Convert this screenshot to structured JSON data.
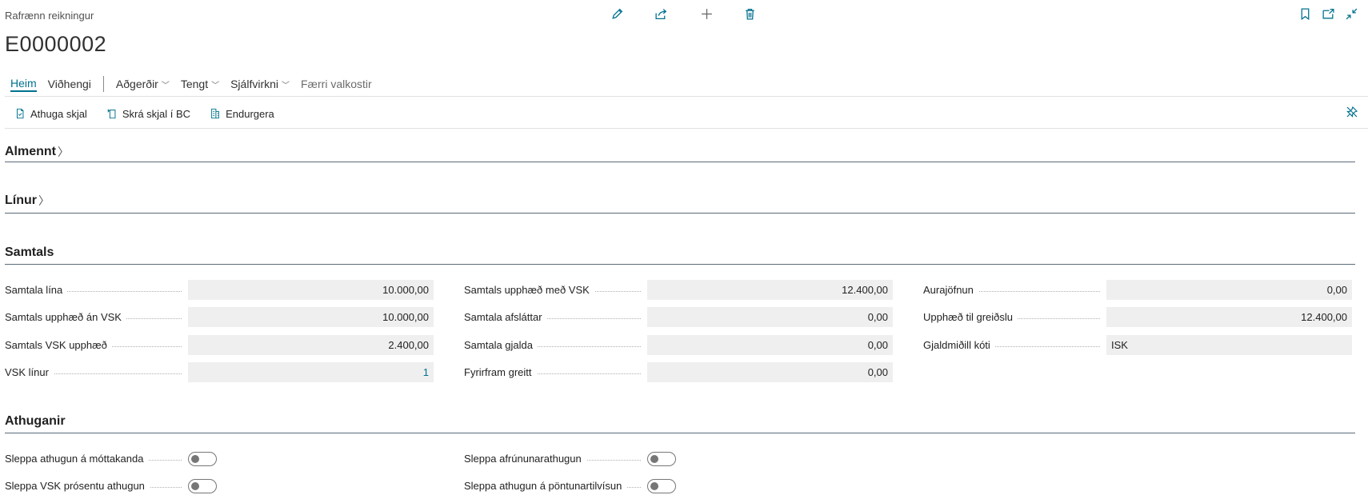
{
  "header": {
    "caption": "Rafrænn reikningur",
    "record_no": "E0000002"
  },
  "icons": {
    "edit": "pencil-icon",
    "share": "share-icon",
    "new": "plus-icon",
    "delete": "trash-icon",
    "bookmark": "bookmark-icon",
    "open_new": "open-new-window-icon",
    "collapse": "collapse-icon",
    "pin": "pin-icon"
  },
  "menu": {
    "items": [
      {
        "label": "Heim"
      },
      {
        "label": "Viðhengi"
      },
      {
        "label": "Aðgerðir"
      },
      {
        "label": "Tengt"
      },
      {
        "label": "Sjálfvirkni"
      },
      {
        "label": "Færri valkostir"
      }
    ]
  },
  "actions": [
    {
      "label": "Athuga skjal"
    },
    {
      "label": "Skrá skjal í BC"
    },
    {
      "label": "Endurgera"
    }
  ],
  "sections": {
    "general": "Almennt",
    "lines": "Línur",
    "totals": "Samtals",
    "checks": "Athuganir"
  },
  "totals": {
    "col1": [
      {
        "label": "Samtala lína",
        "value": "10.000,00"
      },
      {
        "label": "Samtals upphæð án VSK",
        "value": "10.000,00"
      },
      {
        "label": "Samtals VSK upphæð",
        "value": "2.400,00"
      },
      {
        "label": "VSK línur",
        "value": "1"
      }
    ],
    "col2": [
      {
        "label": "Samtals upphæð með VSK",
        "value": "12.400,00"
      },
      {
        "label": "Samtala afsláttar",
        "value": "0,00"
      },
      {
        "label": "Samtala gjalda",
        "value": "0,00"
      },
      {
        "label": "Fyrirfram greitt",
        "value": "0,00"
      }
    ],
    "col3": [
      {
        "label": "Aurajöfnun",
        "value": "0,00"
      },
      {
        "label": "Upphæð til greiðslu",
        "value": "12.400,00"
      },
      {
        "label": "Gjaldmiðill kóti",
        "value": "ISK"
      }
    ]
  },
  "checks": {
    "col1": [
      {
        "label": "Sleppa athugun á móttakanda",
        "on": false
      },
      {
        "label": "Sleppa VSK prósentu athugun",
        "on": false
      }
    ],
    "col2": [
      {
        "label": "Sleppa afrúnunarathugun",
        "on": false
      },
      {
        "label": "Sleppa athugun á pöntunartilvísun",
        "on": false
      }
    ]
  },
  "colors": {
    "accent": "#00718f",
    "field_bg": "#efefef",
    "section_line": "#5a6b78"
  }
}
